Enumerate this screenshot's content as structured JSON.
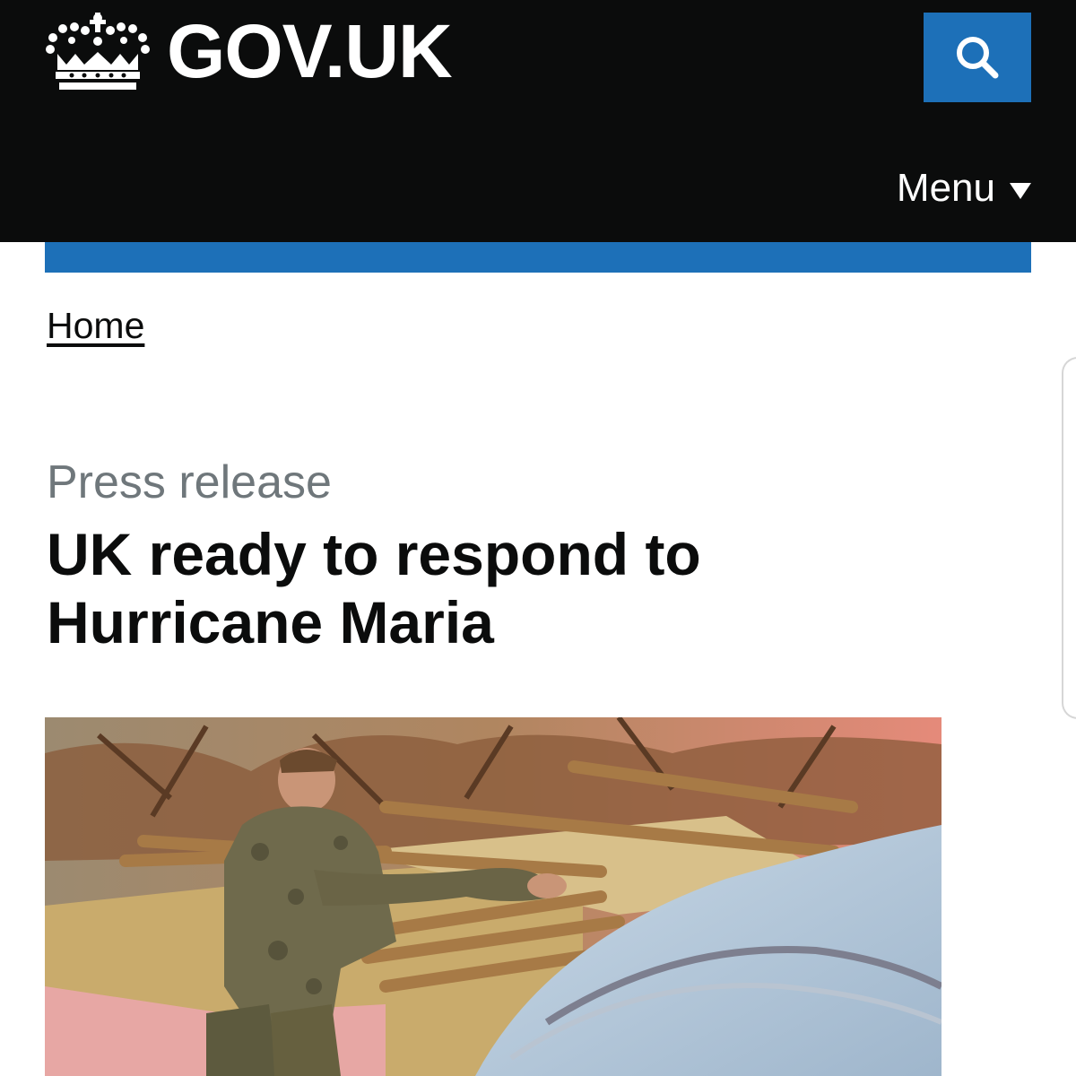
{
  "header": {
    "logo_text": "GOV.UK",
    "search_icon": "search-icon",
    "menu_label": "Menu",
    "colors": {
      "background": "#0b0c0c",
      "accent": "#1d70b8"
    }
  },
  "breadcrumb": {
    "home_label": "Home"
  },
  "article": {
    "caption": "Press release",
    "title": "UK ready to respond to Hurricane Maria"
  }
}
